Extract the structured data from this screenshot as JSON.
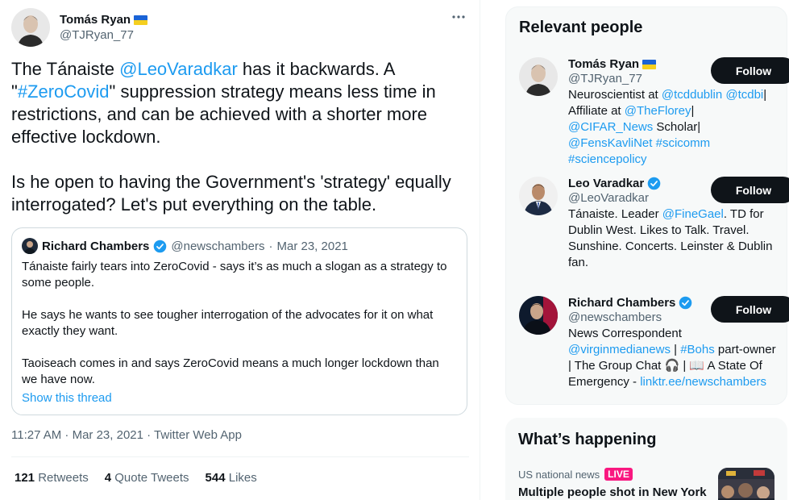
{
  "tweet": {
    "author_name": "Tomás Ryan",
    "author_handle": "@TJRyan_77",
    "more_icon": "more-horizontal-icon",
    "text_1_a": "The Tánaiste ",
    "text_1_mention": "@LeoVaradkar",
    "text_1_b": " has it backwards. A \"",
    "text_1_hashtag": "#ZeroCovid",
    "text_1_c": "\" suppression strategy means less time in restrictions, and can be achieved with a shorter more effective lockdown.",
    "text_2": "Is he open to having the Government's 'strategy' equally interrogated? Let's put everything on the table.",
    "timestamp": "11:27 AM · Mar 23, 2021 · Twitter Web App",
    "stats": {
      "retweets_count": "121",
      "retweets_label": "Retweets",
      "quotes_count": "4",
      "quotes_label": "Quote Tweets",
      "likes_count": "544",
      "likes_label": "Likes"
    }
  },
  "quote": {
    "name": "Richard Chambers",
    "handle": "@newschambers",
    "separator": "·",
    "date": "Mar 23, 2021",
    "para_1": "Tánaiste fairly tears into ZeroCovid - says it’s as much a slogan as a strategy to some people.",
    "para_2": "He says he wants to see tougher interrogation of the advocates for it on what exactly they want.",
    "para_3": "Taoiseach comes in and says ZeroCovid means a much longer lockdown than we have now.",
    "show_thread": "Show this thread"
  },
  "sidebar": {
    "relevant_title": "Relevant people",
    "follow_label": "Follow",
    "people": [
      {
        "name": "Tomás Ryan",
        "handle": "@TJRyan_77",
        "bio_parts": [
          "Neuroscientist at ",
          "@tcddublin",
          " ",
          "@tcdbi",
          "| Affiliate at ",
          "@TheFlorey",
          "| ",
          "@CIFAR_News",
          " Scholar| ",
          "@FensKavliNet",
          " ",
          "#scicomm",
          " ",
          "#sciencepolicy"
        ]
      },
      {
        "name": "Leo Varadkar",
        "handle": "@LeoVaradkar",
        "bio_a": "Tánaiste. Leader ",
        "bio_mention": "@FineGael",
        "bio_b": ". TD for Dublin West. Likes to Talk. Travel. Sunshine. Concerts. Leinster & Dublin fan."
      },
      {
        "name": "Richard Chambers",
        "handle": "@newschambers",
        "bio_a": "News Correspondent ",
        "bio_m1": "@virginmedianews",
        "bio_b": " | ",
        "bio_m2": "#Bohs",
        "bio_c": " part-owner | The Group Chat 🎧 | 📖 A State Of Emergency - ",
        "bio_link": "linktr.ee/newschambers"
      }
    ],
    "happening_title": "What’s happening",
    "trend_category": "US national news",
    "trend_live": "LIVE",
    "trend_title": "Multiple people shot in New York"
  },
  "colors": {
    "link": "#1d9bf0",
    "text": "#0f1419",
    "muted": "#536471",
    "live": "#f91880",
    "follow_bg": "#0f1419"
  }
}
